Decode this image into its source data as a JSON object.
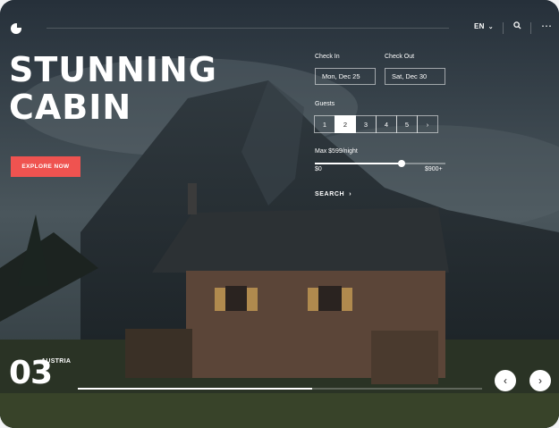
{
  "header": {
    "language": "EN",
    "icons": {
      "logo": "logo-icon",
      "language_chevron": "chevron-down-icon",
      "search": "search-icon",
      "more": "more-icon"
    }
  },
  "hero": {
    "title_line1": "STUNNING",
    "title_line2": "CABIN",
    "cta_label": "EXPLORE NOW",
    "cta_color": "#ef5350"
  },
  "booking": {
    "check_in_label": "Check In",
    "check_in_value": "Mon, Dec 25",
    "check_out_label": "Check Out",
    "check_out_value": "Sat, Dec 30",
    "guests_label": "Guests",
    "guest_options": [
      "1",
      "2",
      "3",
      "4",
      "5",
      "›"
    ],
    "guest_selected": "2",
    "price_label": "Max $599/night",
    "price_min": "$0",
    "price_max": "$900+",
    "price_value_fraction": 0.665,
    "search_label": "SEARCH",
    "search_arrow": "›"
  },
  "slider": {
    "index": "03",
    "country": "AUSTRIA",
    "progress_fraction": 0.58,
    "prev": "‹",
    "next": "›"
  }
}
